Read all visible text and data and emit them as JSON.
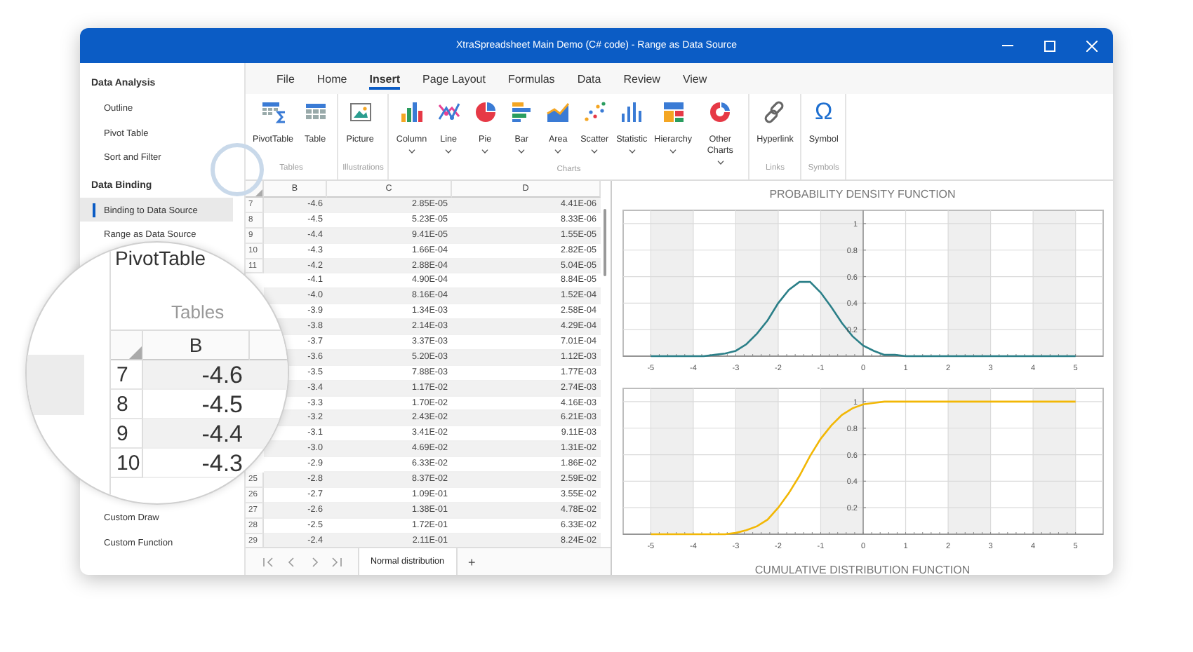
{
  "window": {
    "title": "XtraSpreadsheet Main Demo (C# code) - Range as Data Source"
  },
  "sidebar": {
    "groups": [
      {
        "title": "Data Analysis",
        "items": [
          {
            "label": "Outline",
            "selected": false
          },
          {
            "label": "Pivot Table",
            "selected": false
          },
          {
            "label": "Sort and Filter",
            "selected": false
          }
        ]
      },
      {
        "title": "Data Binding",
        "items": [
          {
            "label": "Binding to Data Source",
            "selected": true
          },
          {
            "label": "Range as Data Source",
            "selected": false
          }
        ]
      },
      {
        "items": [
          {
            "label": "Custom Draw",
            "selected": false
          },
          {
            "label": "Custom Function",
            "selected": false
          }
        ]
      }
    ]
  },
  "ribbon": {
    "tabs": [
      {
        "label": "File",
        "selected": false
      },
      {
        "label": "Home",
        "selected": false
      },
      {
        "label": "Insert",
        "selected": true
      },
      {
        "label": "Page Layout",
        "selected": false
      },
      {
        "label": "Formulas",
        "selected": false
      },
      {
        "label": "Data",
        "selected": false
      },
      {
        "label": "Review",
        "selected": false
      },
      {
        "label": "View",
        "selected": false
      }
    ],
    "groups": [
      {
        "label": "Tables",
        "buttons": [
          {
            "label": "PivotTable",
            "dropdown": false
          },
          {
            "label": "Table",
            "dropdown": false
          }
        ]
      },
      {
        "label": "Illustrations",
        "buttons": [
          {
            "label": "Picture",
            "dropdown": false
          }
        ]
      },
      {
        "label": "Charts",
        "buttons": [
          {
            "label": "Column",
            "dropdown": true
          },
          {
            "label": "Line",
            "dropdown": true
          },
          {
            "label": "Pie",
            "dropdown": true
          },
          {
            "label": "Bar",
            "dropdown": true
          },
          {
            "label": "Area",
            "dropdown": true
          },
          {
            "label": "Scatter",
            "dropdown": true
          },
          {
            "label": "Statistic",
            "dropdown": true
          },
          {
            "label": "Hierarchy",
            "dropdown": true
          },
          {
            "label": "Other Charts",
            "dropdown": true
          }
        ]
      },
      {
        "label": "Links",
        "buttons": [
          {
            "label": "Hyperlink",
            "dropdown": false
          }
        ]
      },
      {
        "label": "Symbols",
        "buttons": [
          {
            "label": "Symbol",
            "glyph": "Ω",
            "dropdown": false
          }
        ]
      }
    ]
  },
  "sheet": {
    "columns": [
      "B",
      "C",
      "D"
    ],
    "rows": [
      {
        "row": "7",
        "cells": [
          "-4.6",
          "2.85E-05",
          "4.41E-06"
        ]
      },
      {
        "row": "8",
        "cells": [
          "-4.5",
          "5.23E-05",
          "8.33E-06"
        ]
      },
      {
        "row": "9",
        "cells": [
          "-4.4",
          "9.41E-05",
          "1.55E-05"
        ]
      },
      {
        "row": "10",
        "cells": [
          "-4.3",
          "1.66E-04",
          "2.82E-05"
        ]
      },
      {
        "row": "11",
        "cells": [
          "-4.2",
          "2.88E-04",
          "5.04E-05"
        ]
      },
      {
        "cells": [
          "-4.1",
          "4.90E-04",
          "8.84E-05"
        ]
      },
      {
        "cells": [
          "-4.0",
          "8.16E-04",
          "1.52E-04"
        ]
      },
      {
        "cells": [
          "-3.9",
          "1.34E-03",
          "2.58E-04"
        ]
      },
      {
        "cells": [
          "-3.8",
          "2.14E-03",
          "4.29E-04"
        ]
      },
      {
        "cells": [
          "-3.7",
          "3.37E-03",
          "7.01E-04"
        ]
      },
      {
        "cells": [
          "-3.6",
          "5.20E-03",
          "1.12E-03"
        ]
      },
      {
        "cells": [
          "-3.5",
          "7.88E-03",
          "1.77E-03"
        ]
      },
      {
        "cells": [
          "-3.4",
          "1.17E-02",
          "2.74E-03"
        ]
      },
      {
        "cells": [
          "-3.3",
          "1.70E-02",
          "4.16E-03"
        ]
      },
      {
        "cells": [
          "-3.2",
          "2.43E-02",
          "6.21E-03"
        ]
      },
      {
        "cells": [
          "-3.1",
          "3.41E-02",
          "9.11E-03"
        ]
      },
      {
        "cells": [
          "-3.0",
          "4.69E-02",
          "1.31E-02"
        ]
      },
      {
        "cells": [
          "-2.9",
          "6.33E-02",
          "1.86E-02"
        ]
      },
      {
        "row": "25",
        "cells": [
          "-2.8",
          "8.37E-02",
          "2.59E-02"
        ]
      },
      {
        "row": "26",
        "cells": [
          "-2.7",
          "1.09E-01",
          "3.55E-02"
        ]
      },
      {
        "row": "27",
        "cells": [
          "-2.6",
          "1.38E-01",
          "4.78E-02"
        ]
      },
      {
        "row": "28",
        "cells": [
          "-2.5",
          "1.72E-01",
          "6.33E-02"
        ]
      },
      {
        "row": "29",
        "cells": [
          "-2.4",
          "2.11E-01",
          "8.24E-02"
        ]
      }
    ],
    "tabs": [
      {
        "label": "Normal distribution",
        "selected": true
      }
    ],
    "add_tab": "+"
  },
  "magnifier": {
    "button_label": "PivotTable",
    "group_label": "Tables",
    "column": "B",
    "rows": [
      {
        "row": "7",
        "value": "-4.6"
      },
      {
        "row": "8",
        "value": "-4.5"
      },
      {
        "row": "9",
        "value": "-4.4"
      },
      {
        "row": "10",
        "value": "-4.3"
      }
    ]
  },
  "charts": [
    {
      "chart_data": {
        "type": "line",
        "title": "PROBABILITY DENSITY FUNCTION",
        "x": [
          -5,
          -4.75,
          -4.5,
          -4.25,
          -4,
          -3.75,
          -3.5,
          -3.25,
          -3,
          -2.75,
          -2.5,
          -2.25,
          -2,
          -1.75,
          -1.5,
          -1.25,
          -1,
          -0.75,
          -0.5,
          -0.25,
          0,
          0.25,
          0.5,
          0.75,
          1,
          1.25,
          1.5,
          1.75,
          2,
          2.25,
          2.5,
          2.75,
          3,
          3.25,
          3.5,
          3.75,
          4,
          4.25,
          4.5,
          4.75,
          5
        ],
        "series": [
          {
            "color": "#2b7f88",
            "values": [
              0,
              0,
              0,
              0,
              0,
              0,
              0.01,
              0.02,
              0.04,
              0.09,
              0.17,
              0.27,
              0.4,
              0.5,
              0.56,
              0.56,
              0.48,
              0.37,
              0.25,
              0.15,
              0.08,
              0.04,
              0.01,
              0.01,
              0,
              0,
              0,
              0,
              0,
              0,
              0,
              0,
              0,
              0,
              0,
              0,
              0,
              0,
              0,
              0,
              0
            ]
          }
        ],
        "xlim": [
          -5.65,
          5.65
        ],
        "ylim": [
          0,
          1.1
        ],
        "xticks": [
          -5,
          -4,
          -3,
          -2,
          -1,
          0,
          1,
          2,
          3,
          4,
          5
        ],
        "yticks": [
          0.2,
          0.4,
          0.6,
          0.8,
          1
        ],
        "grid": true
      }
    },
    {
      "chart_data": {
        "type": "line",
        "title": "CUMULATIVE DISTRIBUTION FUNCTION",
        "x": [
          -5,
          -4.75,
          -4.5,
          -4.25,
          -4,
          -3.75,
          -3.5,
          -3.25,
          -3,
          -2.75,
          -2.5,
          -2.25,
          -2,
          -1.75,
          -1.5,
          -1.25,
          -1,
          -0.75,
          -0.5,
          -0.25,
          0,
          0.25,
          0.5,
          0.75,
          1,
          1.25,
          1.5,
          1.75,
          2,
          2.25,
          2.5,
          2.75,
          3,
          3.25,
          3.5,
          3.75,
          4,
          4.25,
          4.5,
          4.75,
          5
        ],
        "series": [
          {
            "color": "#f2b705",
            "values": [
              0,
              0,
              0,
              0,
              0,
              0,
              0,
              0,
              0.01,
              0.03,
              0.06,
              0.11,
              0.2,
              0.31,
              0.44,
              0.59,
              0.72,
              0.82,
              0.9,
              0.95,
              0.98,
              0.99,
              1,
              1,
              1,
              1,
              1,
              1,
              1,
              1,
              1,
              1,
              1,
              1,
              1,
              1,
              1,
              1,
              1,
              1,
              1
            ]
          }
        ],
        "xlim": [
          -5.65,
          5.65
        ],
        "ylim": [
          0,
          1.1
        ],
        "xticks": [
          -5,
          -4,
          -3,
          -2,
          -1,
          0,
          1,
          2,
          3,
          4,
          5
        ],
        "yticks": [
          0.2,
          0.4,
          0.6,
          0.8,
          1
        ],
        "grid": true
      }
    }
  ]
}
